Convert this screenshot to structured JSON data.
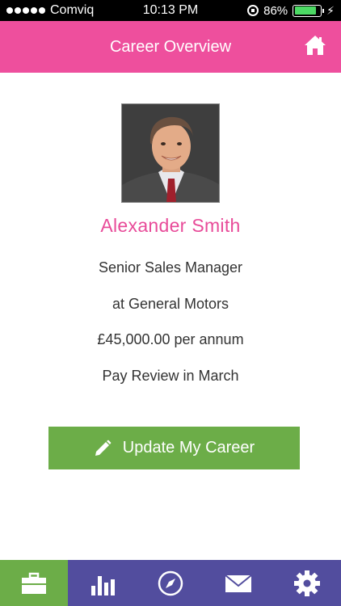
{
  "status_bar": {
    "carrier": "Comviq",
    "time": "10:13 PM",
    "battery_percent": "86%",
    "battery_level": 0.86,
    "signal_bars": 5
  },
  "nav": {
    "title": "Career Overview",
    "home_icon": "home-icon"
  },
  "profile": {
    "name": "Alexander Smith",
    "job_title": "Senior Sales Manager",
    "company": "at General Motors",
    "salary": "£45,000.00 per annum",
    "pay_review": "Pay Review in March"
  },
  "actions": {
    "update_label": "Update My Career",
    "update_icon": "pencil-icon"
  },
  "tabs": [
    {
      "icon": "briefcase-icon",
      "active": true
    },
    {
      "icon": "bar-chart-icon",
      "active": false
    },
    {
      "icon": "compass-icon",
      "active": false
    },
    {
      "icon": "envelope-icon",
      "active": false
    },
    {
      "icon": "gear-icon",
      "active": false
    }
  ],
  "colors": {
    "header_pink": "#ee4f9d",
    "name_pink": "#e84b99",
    "button_green": "#6cad48",
    "tab_bar_purple": "#524d9e"
  }
}
